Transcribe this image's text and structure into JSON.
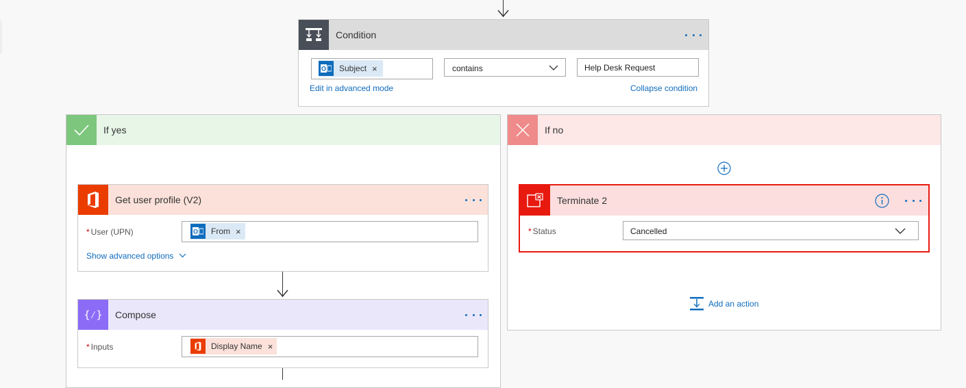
{
  "condition": {
    "title": "Condition",
    "token_label": "Subject",
    "operator": "contains",
    "value": "Help Desk Request",
    "edit_advanced": "Edit in advanced mode",
    "collapse": "Collapse condition"
  },
  "yes_branch": {
    "title": "If yes",
    "get_profile": {
      "title": "Get user profile (V2)",
      "user_label": "User (UPN)",
      "token_label": "From",
      "advanced": "Show advanced options"
    },
    "compose": {
      "title": "Compose",
      "inputs_label": "Inputs",
      "token_label": "Display Name"
    }
  },
  "no_branch": {
    "title": "If no",
    "terminate": {
      "title": "Terminate 2",
      "status_label": "Status",
      "status_value": "Cancelled"
    },
    "add_action": "Add an action"
  },
  "required_mark": "*",
  "colors": {
    "accent": "#0f6cbd",
    "condition_header": "#dcdcdc",
    "condition_icon": "#484f58",
    "yes_header": "#e8f6e8",
    "yes_icon": "#7dc67d",
    "no_header": "#fde7e7",
    "no_icon": "#f08b8b",
    "office_header": "#fbe1da",
    "office_icon": "#eb3c00",
    "compose_header": "#ebe7fb",
    "compose_icon": "#8c6cf7",
    "terminate_header": "#fcdede",
    "terminate_border": "#e8190f",
    "terminate_icon": "#e8190f",
    "outlook_icon": "#0f6cbd"
  }
}
